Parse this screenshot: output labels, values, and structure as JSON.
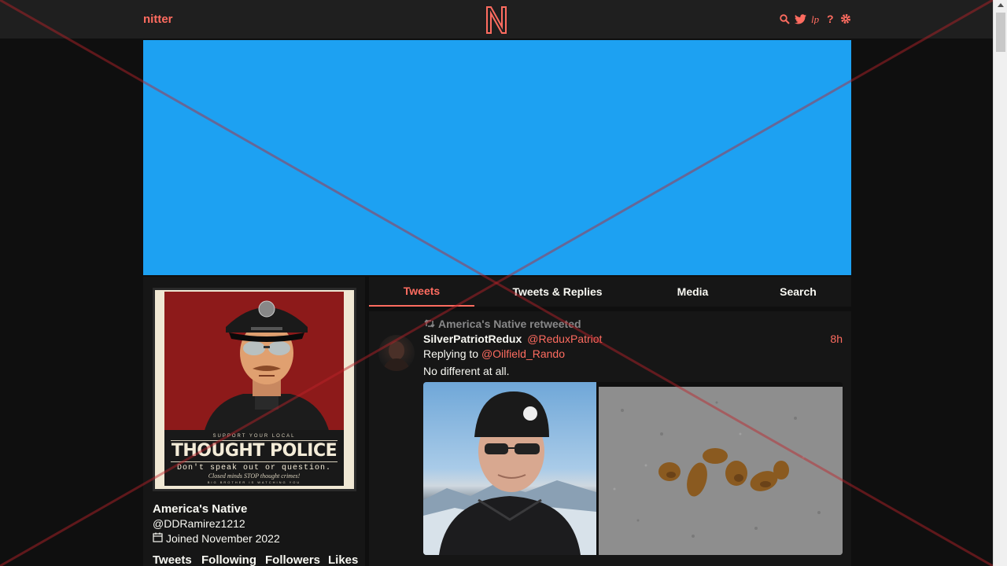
{
  "navbar": {
    "brand": "nitter",
    "logo_letter": "N",
    "icons": [
      "search-icon",
      "twitter-bird-icon",
      "rss-icon",
      "help-icon",
      "gear-icon"
    ]
  },
  "banner": {
    "color": "#1da1f2"
  },
  "profile": {
    "fullname": "America's Native",
    "username": "@DDRamirez1212",
    "joined": "Joined November 2022",
    "avatar_poster": {
      "top_text": "SUPPORT YOUR LOCAL",
      "title": "THOUGHT POLICE",
      "subtitle": "Don't speak out or question.",
      "tagline": "Closed minds STOP thought crimes!",
      "footer": "BIG BROTHER IS WATCHING YOU"
    },
    "stats": [
      {
        "label": "Tweets"
      },
      {
        "label": "Following"
      },
      {
        "label": "Followers"
      },
      {
        "label": "Likes"
      }
    ]
  },
  "tabs": [
    {
      "label": "Tweets",
      "active": true
    },
    {
      "label": "Tweets & Replies",
      "active": false
    },
    {
      "label": "Media",
      "active": false
    },
    {
      "label": "Search",
      "active": false
    }
  ],
  "tweet": {
    "retweet_header": "America's Native retweeted",
    "fullname": "SilverPatriotRedux",
    "username": "@ReduxPatriot",
    "date": "8h",
    "replying_prefix": "Replying to",
    "replying_to": "@Oilfield_Rando",
    "text": "No different at all.",
    "stats_partial": " "
  },
  "colors": {
    "accent": "#ff6c60",
    "background": "#0f0f0f",
    "panel": "#161616",
    "navbar": "#1f1f1f",
    "muted": "#888889",
    "overlay_red": "#c0232a"
  }
}
